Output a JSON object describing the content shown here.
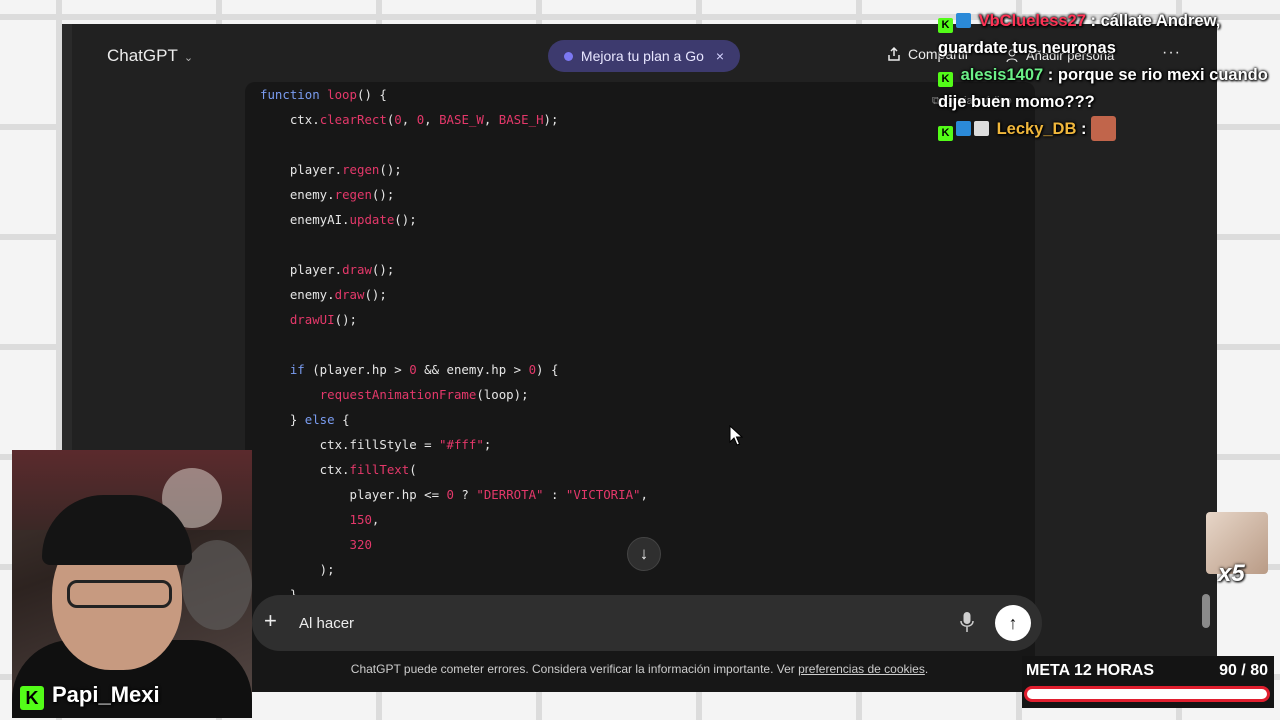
{
  "app": {
    "model_name": "ChatGPT",
    "upgrade_label": "Mejora tu plan a Go",
    "upgrade_close": "×",
    "share_label": "Compartir",
    "add_people_label": "Añadir persona",
    "more_label": "···"
  },
  "code": {
    "copy_label": "Copiar código",
    "lines": [
      [
        {
          "t": "function ",
          "c": "k"
        },
        {
          "t": "loop",
          "c": "f"
        },
        {
          "t": "() {",
          "c": ""
        }
      ],
      [
        {
          "t": "    ctx.",
          "c": ""
        },
        {
          "t": "clearRect",
          "c": "f"
        },
        {
          "t": "(",
          "c": ""
        },
        {
          "t": "0",
          "c": "n"
        },
        {
          "t": ", ",
          "c": ""
        },
        {
          "t": "0",
          "c": "n"
        },
        {
          "t": ", ",
          "c": ""
        },
        {
          "t": "BASE_W",
          "c": "n"
        },
        {
          "t": ", ",
          "c": ""
        },
        {
          "t": "BASE_H",
          "c": "n"
        },
        {
          "t": ");",
          "c": ""
        }
      ],
      [],
      [
        {
          "t": "    player.",
          "c": ""
        },
        {
          "t": "regen",
          "c": "f"
        },
        {
          "t": "();",
          "c": ""
        }
      ],
      [
        {
          "t": "    enemy.",
          "c": ""
        },
        {
          "t": "regen",
          "c": "f"
        },
        {
          "t": "();",
          "c": ""
        }
      ],
      [
        {
          "t": "    enemyAI.",
          "c": ""
        },
        {
          "t": "update",
          "c": "f"
        },
        {
          "t": "();",
          "c": ""
        }
      ],
      [],
      [
        {
          "t": "    player.",
          "c": ""
        },
        {
          "t": "draw",
          "c": "f"
        },
        {
          "t": "();",
          "c": ""
        }
      ],
      [
        {
          "t": "    enemy.",
          "c": ""
        },
        {
          "t": "draw",
          "c": "f"
        },
        {
          "t": "();",
          "c": ""
        }
      ],
      [
        {
          "t": "    ",
          "c": ""
        },
        {
          "t": "drawUI",
          "c": "f"
        },
        {
          "t": "();",
          "c": ""
        }
      ],
      [],
      [
        {
          "t": "    ",
          "c": ""
        },
        {
          "t": "if",
          "c": "k"
        },
        {
          "t": " (player.hp > ",
          "c": ""
        },
        {
          "t": "0",
          "c": "n"
        },
        {
          "t": " && enemy.hp > ",
          "c": ""
        },
        {
          "t": "0",
          "c": "n"
        },
        {
          "t": ") {",
          "c": ""
        }
      ],
      [
        {
          "t": "        ",
          "c": ""
        },
        {
          "t": "requestAnimationFrame",
          "c": "f"
        },
        {
          "t": "(loop);",
          "c": ""
        }
      ],
      [
        {
          "t": "    } ",
          "c": ""
        },
        {
          "t": "else",
          "c": "k"
        },
        {
          "t": " {",
          "c": ""
        }
      ],
      [
        {
          "t": "        ctx.fillStyle = ",
          "c": ""
        },
        {
          "t": "\"#fff\"",
          "c": "s"
        },
        {
          "t": ";",
          "c": ""
        }
      ],
      [
        {
          "t": "        ctx.",
          "c": ""
        },
        {
          "t": "fillText",
          "c": "f"
        },
        {
          "t": "(",
          "c": ""
        }
      ],
      [
        {
          "t": "            player.hp <= ",
          "c": ""
        },
        {
          "t": "0",
          "c": "n"
        },
        {
          "t": " ? ",
          "c": ""
        },
        {
          "t": "\"DERROTA\"",
          "c": "s"
        },
        {
          "t": " : ",
          "c": ""
        },
        {
          "t": "\"VICTORIA\"",
          "c": "s"
        },
        {
          "t": ",",
          "c": ""
        }
      ],
      [
        {
          "t": "            ",
          "c": ""
        },
        {
          "t": "150",
          "c": "n"
        },
        {
          "t": ",",
          "c": ""
        }
      ],
      [
        {
          "t": "            ",
          "c": ""
        },
        {
          "t": "320",
          "c": "n"
        }
      ],
      [
        {
          "t": "        );",
          "c": ""
        }
      ],
      [
        {
          "t": "    }",
          "c": ""
        }
      ]
    ]
  },
  "composer": {
    "input_value": "Al hacer ",
    "plus_label": "+",
    "send_label": "↑"
  },
  "footer": {
    "disclaimer_text": "ChatGPT puede cometer errores. Considera verificar la información importante. Ver ",
    "disclaimer_link": "preferencias de cookies",
    "disclaimer_end": "."
  },
  "chat": {
    "messages": [
      {
        "user": "VbClueless27",
        "text": ": cállate Andrew, guardate tus neuronas"
      },
      {
        "user": "alesis1407",
        "text": ": porque se rio mexi cuando dije buen momo???"
      },
      {
        "user": "Lecky_DB",
        "text": ":"
      }
    ]
  },
  "stream": {
    "streamer_name": "Papi_Mexi",
    "emote_multiplier": "x5",
    "goal_label": "META 12 HORAS",
    "goal_count": "90 / 80"
  },
  "colors": {
    "kick_green": "#53fc18",
    "upgrade_bg": "#3d3a6e",
    "goal_red": "#e01e2e"
  },
  "icons": [
    "chevron-down-icon",
    "close-icon",
    "share-icon",
    "add-person-icon",
    "more-icon",
    "copy-icon",
    "plus-icon",
    "microphone-icon",
    "send-arrow-icon",
    "arrow-down-icon",
    "cursor-icon",
    "kick-badge-icon"
  ]
}
